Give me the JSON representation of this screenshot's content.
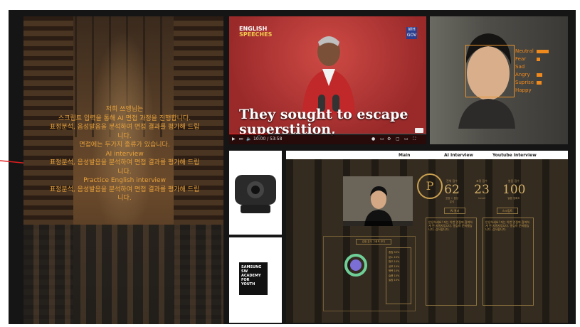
{
  "library_panel": {
    "lines": [
      "저희 쓰앵님는",
      "스크립트 입력을 통해 AI 면접 과정을 진행합니다.",
      "표정분석, 음성발음을 분석하여 면접 결과를 평가해 드립",
      "니다.",
      "면접에는 두가지 종류가 있습니다.",
      "AI interview",
      "표정분석, 음성발음을 분석하여 면접 결과를 평가해 드립",
      "니다.",
      "Practice English interview",
      "표정분석, 음성발음을 분석하여 면접 결과를 평가해 드립",
      "니다."
    ]
  },
  "video_panel": {
    "brand_top": "ENGLISH",
    "brand_bottom": "SPEECHES",
    "badge": "WH GOV",
    "caption_line1": "They sought to escape",
    "caption_line2": "superstition,",
    "time": "10:00 / 53:58",
    "progress": 0.2
  },
  "webcam_panel": {
    "emotions": [
      {
        "label": "Neutral",
        "level": 0.55
      },
      {
        "label": "Fear",
        "level": 0.18
      },
      {
        "label": "Sad",
        "level": 0.0
      },
      {
        "label": "Angry",
        "level": 0.28
      },
      {
        "label": "Suprise",
        "level": 0.22
      },
      {
        "label": "Happy",
        "level": 0.0
      }
    ],
    "accent": "#f08a1c"
  },
  "samsung_logo": {
    "lines": [
      "SAMSUNG",
      "SW",
      "ACADEMY",
      "FOR",
      "YOUTH"
    ]
  },
  "site_panel": {
    "nav": {
      "main": "Main",
      "ai": "AI Interview",
      "youtube": "Youtube Interview"
    },
    "emblem": "P",
    "stats": [
      {
        "label": "전체 점수",
        "value": "62",
        "sub": "표정 + 음성 분석"
      },
      {
        "label": "표정 점수",
        "value": "23",
        "sub": "Level"
      },
      {
        "label": "발음 점수",
        "value": "100",
        "sub": "발음 정확도"
      }
    ],
    "buttons": {
      "left": "AI 결과",
      "right": "스크립트"
    },
    "graph_button": "감정 분석 그래프 보기",
    "text_left": "안녕하세요! 저는 이번 면접에 참여하게 된 지원자입니다. 열심히 준비했습니다. 감사합니다.",
    "text_right": "안녕하세요! 저는 이번 면접에 참여하게 된 지원자입니다. 열심히 준비했습니다. 감사합니다.",
    "emotion_list": [
      "중립 50%",
      "분노 10%",
      "혐오 10%",
      "공포 10%",
      "행복 10%",
      "슬픔 10%",
      "놀람 10%"
    ]
  }
}
